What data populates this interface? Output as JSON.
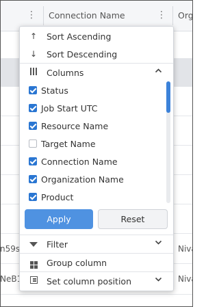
{
  "grid": {
    "header": {
      "connection_col_label": "Connection Name",
      "org_col_label_partial": "Orga"
    },
    "rows_bottom": [
      {
        "connection_partial": "n59s1",
        "org_partial": "Niva"
      },
      {
        "connection_partial": "NeB1",
        "org_partial": "Niva"
      }
    ]
  },
  "menu": {
    "sort_ascending": "Sort Ascending",
    "sort_descending": "Sort Descending",
    "columns_label": "Columns",
    "column_items": [
      {
        "label": "Status",
        "checked": true
      },
      {
        "label": "Job Start UTC",
        "checked": true
      },
      {
        "label": "Resource Name",
        "checked": true
      },
      {
        "label": "Target Name",
        "checked": false
      },
      {
        "label": "Connection Name",
        "checked": true
      },
      {
        "label": "Organization Name",
        "checked": true
      },
      {
        "label": "Product",
        "checked": true
      }
    ],
    "apply_label": "Apply",
    "reset_label": "Reset",
    "filter_label": "Filter",
    "group_column_label": "Group column",
    "set_position_label": "Set column position"
  },
  "colors": {
    "accent": "#2a76d2",
    "apply_button": "#4f92e1"
  }
}
